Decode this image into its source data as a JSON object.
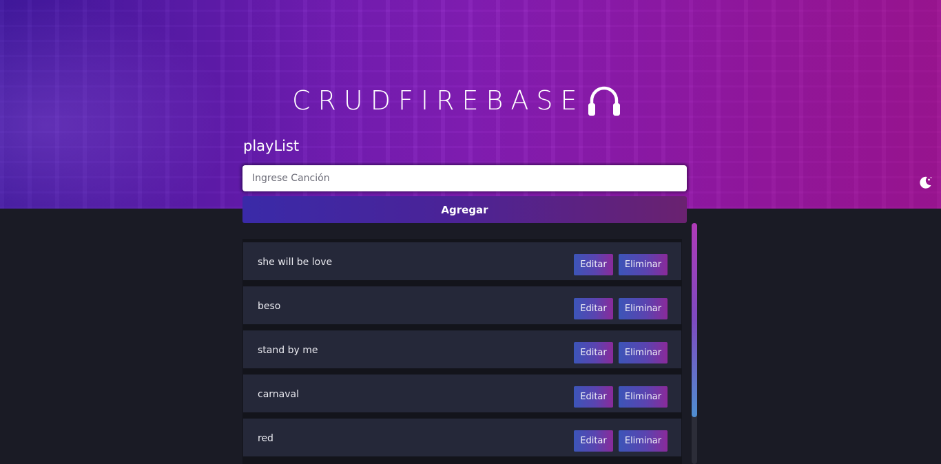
{
  "header": {
    "logo_text": "CRUDFIREBASE",
    "logo_icon": "headphones-icon",
    "subtitle": "playList"
  },
  "form": {
    "input_placeholder": "Ingrese Canción",
    "input_value": "",
    "add_label": "Agregar"
  },
  "theme_toggle_icon": "moon-star-icon",
  "songs": [
    {
      "title": "she will be love",
      "edit_label": "Editar",
      "delete_label": "Eliminar"
    },
    {
      "title": "beso",
      "edit_label": "Editar",
      "delete_label": "Eliminar"
    },
    {
      "title": "stand by me",
      "edit_label": "Editar",
      "delete_label": "Eliminar"
    },
    {
      "title": "carnaval",
      "edit_label": "Editar",
      "delete_label": "Eliminar"
    },
    {
      "title": "red",
      "edit_label": "Editar",
      "delete_label": "Eliminar"
    }
  ],
  "colors": {
    "page_background": "#1a1b25",
    "item_background": "#252839",
    "accent_purple": "#8f1ab0",
    "accent_blue": "#3c55b8"
  }
}
